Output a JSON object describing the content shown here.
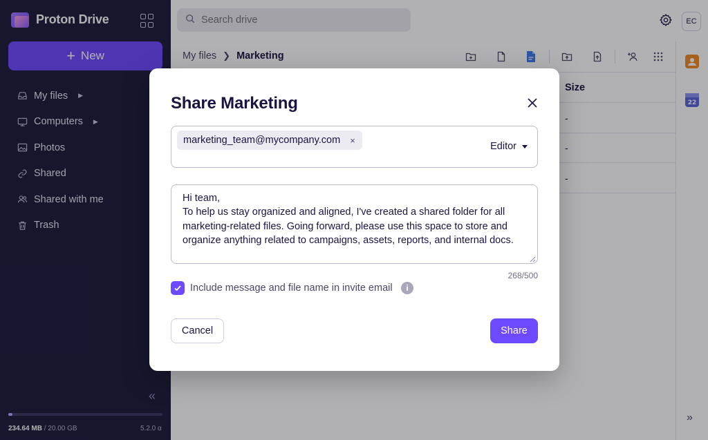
{
  "app": {
    "brand": "Proton Drive",
    "accent": "#6d4aff",
    "sidebar_bg": "#1c1b3a"
  },
  "sidebar": {
    "new_label": "New",
    "items": [
      {
        "label": "My files",
        "icon": "inbox-icon",
        "has_caret": true
      },
      {
        "label": "Computers",
        "icon": "monitor-icon",
        "has_caret": true
      },
      {
        "label": "Photos",
        "icon": "image-icon",
        "has_caret": false
      },
      {
        "label": "Shared",
        "icon": "link-icon",
        "has_caret": false
      },
      {
        "label": "Shared with me",
        "icon": "users-icon",
        "has_caret": false
      },
      {
        "label": "Trash",
        "icon": "trash-icon",
        "has_caret": false
      }
    ],
    "storage": {
      "used": "234.64 MB",
      "total": "/ 20.00 GB",
      "fill_fraction": 0.025
    },
    "version": "5.2.0 α"
  },
  "topbar": {
    "search_placeholder": "Search drive",
    "avatar_initials": "EC"
  },
  "main": {
    "breadcrumb": [
      "My files",
      "Marketing"
    ],
    "columns": {
      "size": "Size"
    },
    "rows": [
      {
        "size": "-"
      },
      {
        "size": "-"
      },
      {
        "size": "-"
      }
    ]
  },
  "rail": {
    "calendar_day": "22"
  },
  "modal": {
    "title": "Share Marketing",
    "recipient": "marketing_team@mycompany.com",
    "role": "Editor",
    "message": "Hi team,\nTo help us stay organized and aligned, I've created a shared folder for all marketing-related files. Going forward, please use this space to store and organize anything related to campaigns, assets, reports, and internal docs.",
    "char_count": "268/500",
    "include_label": "Include message and file name in invite email",
    "include_checked": true,
    "cancel_label": "Cancel",
    "share_label": "Share"
  }
}
